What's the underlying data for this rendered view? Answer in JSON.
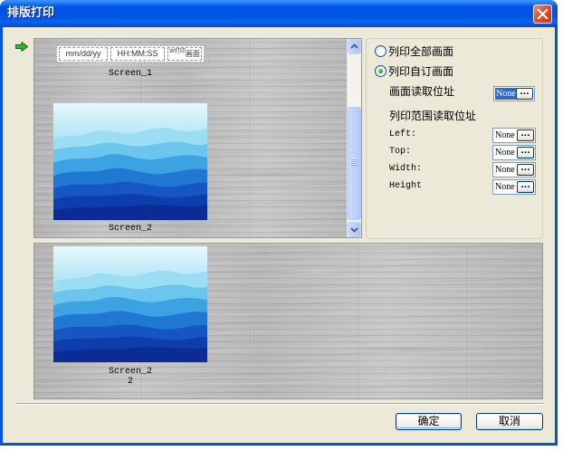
{
  "window": {
    "title": "排版打印"
  },
  "top_preview": {
    "header": {
      "date_format": "mm/dd/yy",
      "time_format": "HH:MM:SS",
      "print_icon_caption": "W打印",
      "print_icon_label": "画面"
    },
    "screen_1_label": "Screen_1",
    "screen_2_label": "Screen_2"
  },
  "options": {
    "print_all": {
      "label": "列印全部画面",
      "checked": false
    },
    "print_custom": {
      "label": "列印自订画面",
      "checked": true
    },
    "screen_address": {
      "label": "画面读取位址",
      "value": "None"
    },
    "range_title": "列印范围读取位址",
    "range_fields": [
      {
        "label": "Left:",
        "value": "None"
      },
      {
        "label": "Top:",
        "value": "None"
      },
      {
        "label": "Width:",
        "value": "None"
      },
      {
        "label": "Height",
        "value": "None"
      }
    ],
    "browse_label": "..."
  },
  "bottom_preview": {
    "screen_label": "Screen_2",
    "screen_index": "2"
  },
  "buttons": {
    "ok": "确定",
    "cancel": "取消"
  },
  "icons": {
    "status": "green-arrow-icon",
    "close": "close-icon",
    "scroll_up": "scroll-up-arrow-icon",
    "scroll_down": "scroll-down-arrow-icon",
    "print_screen": "print-screen-icon",
    "thumbnail": "blue-mountains-image"
  },
  "colors": {
    "title_bar": "#0054E3",
    "dialog_bg": "#ECE9D8",
    "selection": "#316AC5",
    "close_button": "#D7532D",
    "preview_wood": "#BDBDBD"
  }
}
